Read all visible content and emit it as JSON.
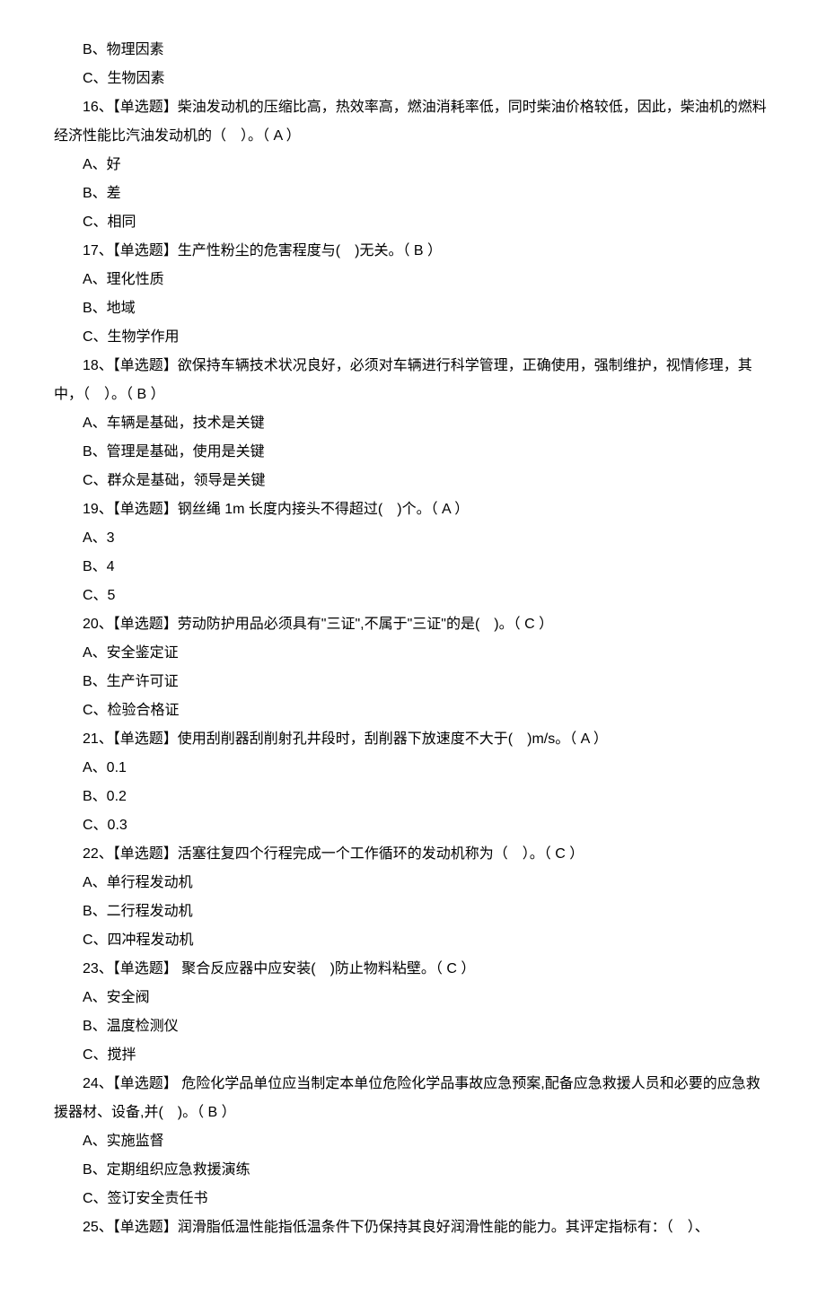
{
  "lines": {
    "q15_b": "B、物理因素",
    "q15_c": "C、生物因素",
    "q16_stem": "16、【单选题】柴油发动机的压缩比高，热效率高，燃油消耗率低，同时柴油价格较低，因此，柴油机的燃料经济性能比汽油发动机的（　）。（ A ）",
    "q16_a": "A、好",
    "q16_b": "B、差",
    "q16_c": "C、相同",
    "q17_stem": "17、【单选题】生产性粉尘的危害程度与(　)无关。（ B ）",
    "q17_a": "A、理化性质",
    "q17_b": "B、地域",
    "q17_c": "C、生物学作用",
    "q18_stem": "18、【单选题】欲保持车辆技术状况良好，必须对车辆进行科学管理，正确使用，强制维护，视情修理，其中，（　）。（ B ）",
    "q18_a": "A、车辆是基础，技术是关键",
    "q18_b": "B、管理是基础，使用是关键",
    "q18_c": "C、群众是基础，领导是关键",
    "q19_stem": "19、【单选题】钢丝绳 1m 长度内接头不得超过(　)个。（ A ）",
    "q19_a": "A、3",
    "q19_b": "B、4",
    "q19_c": "C、5",
    "q20_stem": "20、【单选题】劳动防护用品必须具有\"三证\",不属于\"三证\"的是(　)。（ C ）",
    "q20_a": "A、安全鉴定证",
    "q20_b": "B、生产许可证",
    "q20_c": "C、检验合格证",
    "q21_stem": "21、【单选题】使用刮削器刮削射孔井段时，刮削器下放速度不大于(　)m/s。（ A ）",
    "q21_a": "A、0.1",
    "q21_b": "B、0.2",
    "q21_c": "C、0.3",
    "q22_stem": "22、【单选题】活塞往复四个行程完成一个工作循环的发动机称为（　）。（ C ）",
    "q22_a": "A、单行程发动机",
    "q22_b": "B、二行程发动机",
    "q22_c": "C、四冲程发动机",
    "q23_stem": "23、【单选题】 聚合反应器中应安装(　)防止物料粘壁。（ C ）",
    "q23_a": "A、安全阀",
    "q23_b": "B、温度检测仪",
    "q23_c": "C、搅拌",
    "q24_stem": "24、【单选题】 危险化学品单位应当制定本单位危险化学品事故应急预案,配备应急救援人员和必要的应急救援器材、设备,并(　)。（ B ）",
    "q24_a": "A、实施监督",
    "q24_b": "B、定期组织应急救援演练",
    "q24_c": "C、签订安全责任书",
    "q25_stem": "25、【单选题】润滑脂低温性能指低温条件下仍保持其良好润滑性能的能力。其评定指标有：（　）、"
  }
}
